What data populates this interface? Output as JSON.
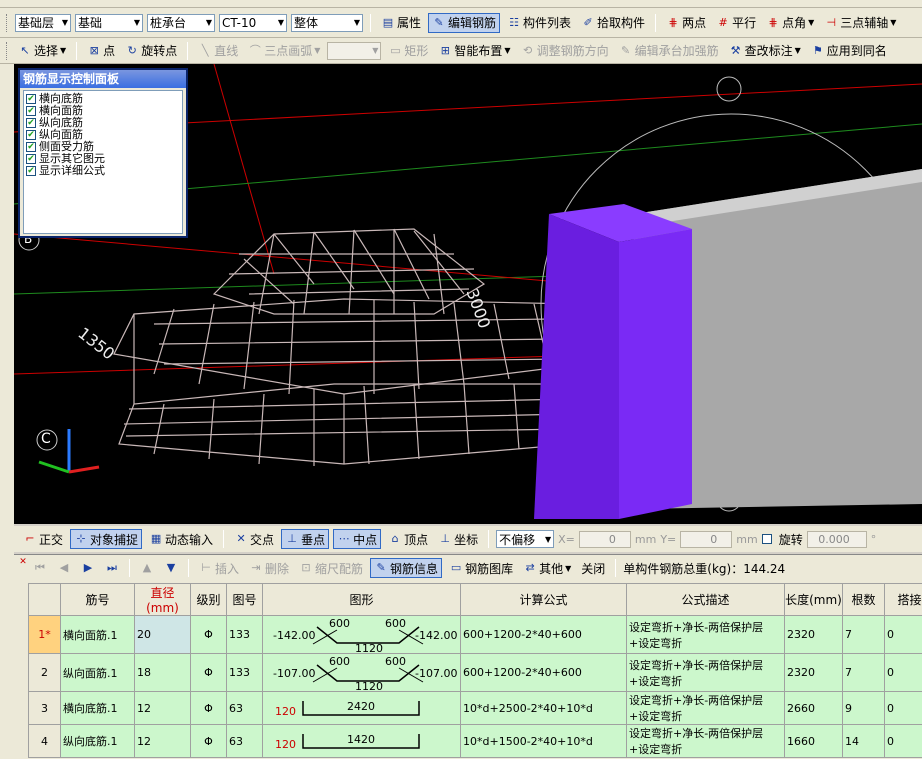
{
  "toolbar1": {
    "combos": [
      {
        "value": "基础层"
      },
      {
        "value": "基础"
      },
      {
        "value": "桩承台"
      },
      {
        "value": "CT-10"
      },
      {
        "value": "整体"
      }
    ],
    "buttons": {
      "properties": "属性",
      "edit_rebar": "编辑钢筋",
      "component_list": "构件列表",
      "pick_component": "拾取构件",
      "two_points": "两点",
      "parallel": "平行",
      "point_angle": "点角",
      "three_point_axis": "三点辅轴"
    }
  },
  "toolbar2": {
    "select": "选择",
    "point": "点",
    "rotate_point": "旋转点",
    "line": "直线",
    "three_point_arc": "三点画弧",
    "rectangle": "矩形",
    "smart_layout": "智能布置",
    "adjust_rebar_direction": "调整钢筋方向",
    "edit_cap_reinforcement": "编辑承台加强筋",
    "modify_annotation": "查改标注",
    "apply_same_name": "应用到同名"
  },
  "control_panel": {
    "title": "钢筋显示控制面板",
    "items": [
      {
        "label": "横向底筋",
        "checked": true
      },
      {
        "label": "横向面筋",
        "checked": true
      },
      {
        "label": "纵向底筋",
        "checked": true
      },
      {
        "label": "纵向面筋",
        "checked": true
      },
      {
        "label": "侧面受力筋",
        "checked": true
      },
      {
        "label": "显示其它图元",
        "checked": true
      },
      {
        "label": "显示详细公式",
        "checked": true
      }
    ]
  },
  "viewport": {
    "dim_left": "1350",
    "dim_top": "3000",
    "marker_b": "B",
    "marker_c": "C"
  },
  "snapbar": {
    "orthogonal": "正交",
    "object_snap": "对象捕捉",
    "dynamic_input": "动态输入",
    "intersection": "交点",
    "perpendicular": "垂点",
    "midpoint": "中点",
    "vertex": "顶点",
    "coordinate": "坐标",
    "offset_mode": "不偏移",
    "x_label": "X=",
    "x_value": "0",
    "y_label": "Y=",
    "y_value": "0",
    "unit": "mm",
    "rotate": "旋转",
    "rotate_value": "0.000",
    "degree": "°"
  },
  "rebar_toolbar": {
    "insert": "插入",
    "delete": "删除",
    "scale_rebar": "缩尺配筋",
    "rebar_info": "钢筋信息",
    "rebar_library": "钢筋图库",
    "other": "其他",
    "close": "关闭",
    "total_weight": "单构件钢筋总重(kg)：144.24"
  },
  "rebar_table": {
    "headers": [
      "筋号",
      "直径(mm)",
      "级别",
      "图号",
      "图形",
      "计算公式",
      "公式描述",
      "长度(mm)",
      "根数",
      "搭接"
    ],
    "rows": [
      {
        "no": "1*",
        "name": "横向面筋.1",
        "diameter": "20",
        "grade": "Φ",
        "fig": "133",
        "shape": {
          "left": "-142.00",
          "right": "-142.00",
          "seg1": "600",
          "seg2": "600",
          "bottom": "1120"
        },
        "formula": "600+1200-2*40+600",
        "desc": "设定弯折+净长-两倍保护层+设定弯折",
        "length": "2320",
        "count": "7",
        "lap": "0"
      },
      {
        "no": "2",
        "name": "纵向面筋.1",
        "diameter": "18",
        "grade": "Φ",
        "fig": "133",
        "shape": {
          "left": "-107.00",
          "right": "-107.00",
          "seg1": "600",
          "seg2": "600",
          "bottom": "1120"
        },
        "formula": "600+1200-2*40+600",
        "desc": "设定弯折+净长-两倍保护层+设定弯折",
        "length": "2320",
        "count": "7",
        "lap": "0"
      },
      {
        "no": "3",
        "name": "横向底筋.1",
        "diameter": "12",
        "grade": "Φ",
        "fig": "63",
        "shape": {
          "hook": "120",
          "span": "2420"
        },
        "formula": "10*d+2500-2*40+10*d",
        "desc": "设定弯折+净长-两倍保护层+设定弯折",
        "length": "2660",
        "count": "9",
        "lap": "0"
      },
      {
        "no": "4",
        "name": "纵向底筋.1",
        "diameter": "12",
        "grade": "Φ",
        "fig": "63",
        "shape": {
          "hook": "120",
          "span": "1420"
        },
        "formula": "10*d+1500-2*40+10*d",
        "desc": "设定弯折+净长-两倍保护层+设定弯折",
        "length": "1660",
        "count": "14",
        "lap": "0"
      }
    ]
  }
}
